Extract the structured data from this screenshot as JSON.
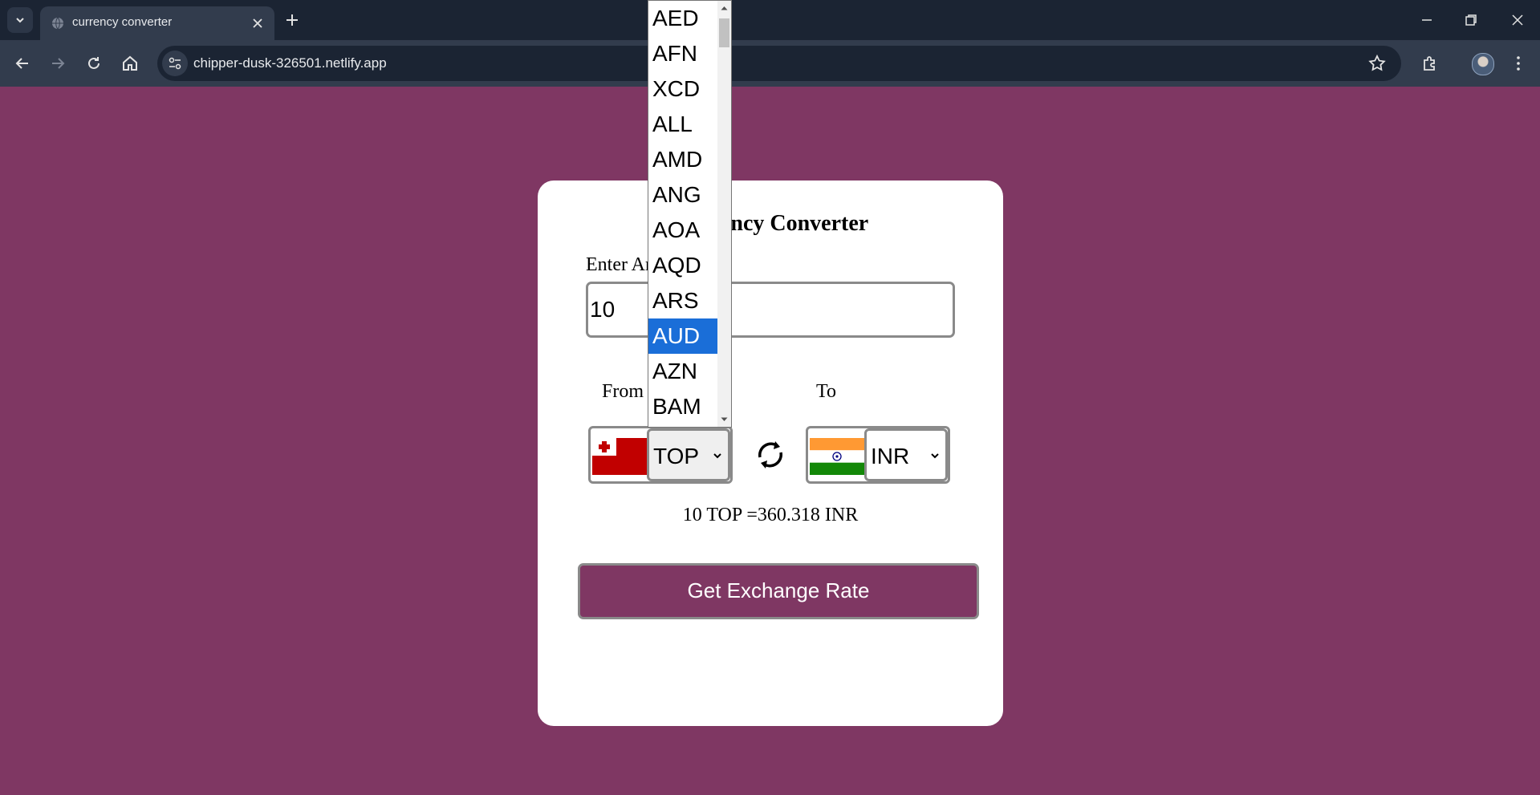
{
  "browser": {
    "tab_title": "currency converter",
    "url": "chipper-dusk-326501.netlify.app",
    "icons": [
      "tab-search-icon",
      "globe-icon",
      "close-icon",
      "plus-icon",
      "minimize-icon",
      "restore-icon",
      "close-window-icon",
      "back-icon",
      "forward-icon",
      "reload-icon",
      "home-icon",
      "site-info-icon",
      "star-icon",
      "extensions-icon",
      "avatar",
      "kebab-menu-icon"
    ]
  },
  "app": {
    "title": "Currency Converter",
    "amount_label": "Enter Amount",
    "amount_value": "10",
    "from_label": "From",
    "to_label": "To",
    "from_currency": "TOP",
    "to_currency": "INR",
    "result_text": "10 TOP =360.318 INR",
    "button_label": "Get Exchange Rate",
    "background_color": "#7f3763"
  },
  "dropdown": {
    "options": [
      "AED",
      "AFN",
      "XCD",
      "ALL",
      "AMD",
      "ANG",
      "AOA",
      "AQD",
      "ARS",
      "AUD",
      "AZN",
      "BAM"
    ],
    "highlighted": "AUD",
    "highlight_color": "#1a6ed8"
  }
}
